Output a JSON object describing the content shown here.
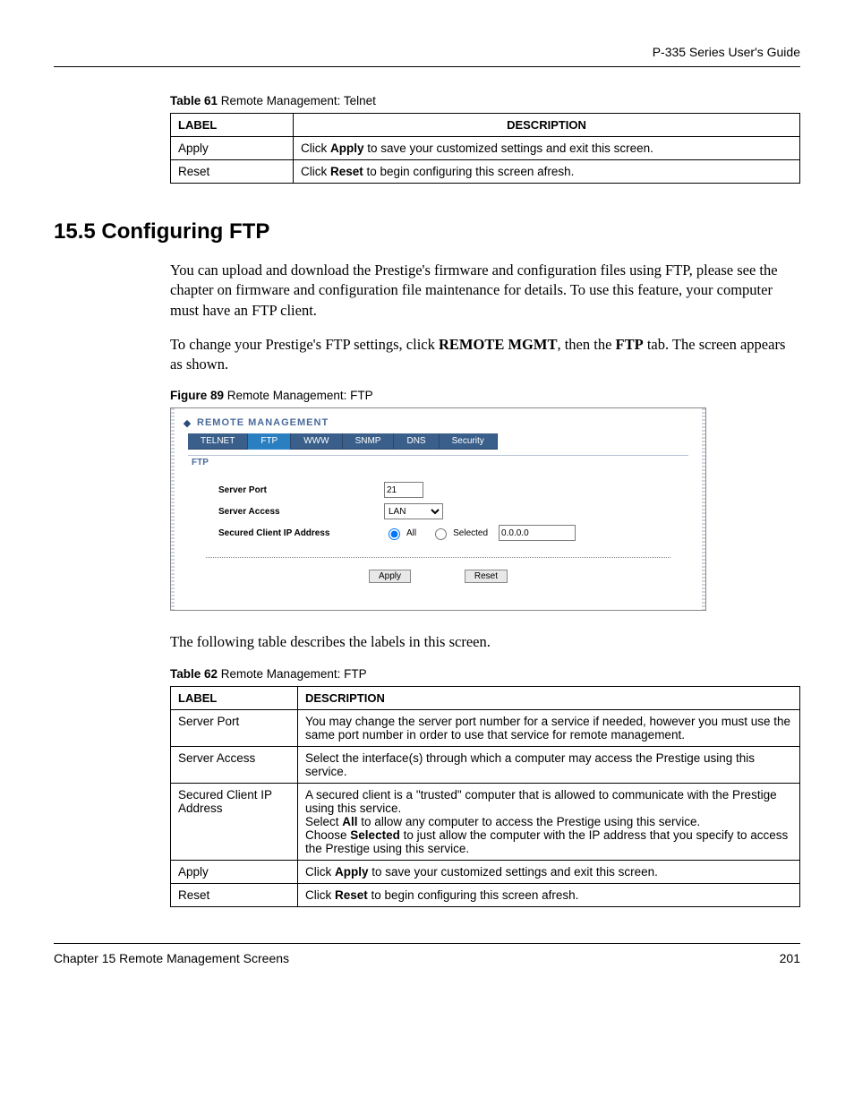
{
  "header": {
    "doc_title": "P-335 Series User's Guide"
  },
  "table61": {
    "caption_bold": "Table 61",
    "caption_rest": "   Remote Management: Telnet",
    "head_label": "LABEL",
    "head_desc": "DESCRIPTION",
    "rows": [
      {
        "label": "Apply",
        "pre": "Click ",
        "bold": "Apply",
        "post": " to save your customized settings and exit this screen."
      },
      {
        "label": "Reset",
        "pre": "Click ",
        "bold": "Reset",
        "post": " to begin configuring this screen afresh."
      }
    ]
  },
  "section": {
    "heading": "15.5  Configuring FTP",
    "p1": "You can upload and download the Prestige's firmware and configuration files using FTP, please see the chapter on firmware and configuration file maintenance for details. To use this feature, your computer must have an FTP client.",
    "p2_pre": "To change your Prestige's FTP settings, click ",
    "p2_b1": "REMOTE MGMT",
    "p2_mid": ", then the ",
    "p2_b2": "FTP",
    "p2_post": " tab. The screen appears as shown."
  },
  "figure89": {
    "caption_bold": "Figure 89",
    "caption_rest": "   Remote Management: FTP",
    "panel_title": "REMOTE MANAGEMENT",
    "tabs": [
      "TELNET",
      "FTP",
      "WWW",
      "SNMP",
      "DNS",
      "Security"
    ],
    "active_tab_index": 1,
    "sub_label": "FTP",
    "fields": {
      "server_port_label": "Server Port",
      "server_port_value": "21",
      "server_access_label": "Server Access",
      "server_access_value": "LAN",
      "secured_label": "Secured Client IP Address",
      "radio_all": "All",
      "radio_selected": "Selected",
      "ip_value": "0.0.0.0"
    },
    "buttons": {
      "apply": "Apply",
      "reset": "Reset"
    }
  },
  "after_fig_text": "The following table describes the labels in this screen.",
  "table62": {
    "caption_bold": "Table 62",
    "caption_rest": "   Remote Management: FTP",
    "head_label": "LABEL",
    "head_desc": "DESCRIPTION",
    "rows": [
      {
        "label": "Server Port",
        "lines": [
          {
            "t": "You may change the server port number for a service if needed, however you must use the same port number in order to use that service for remote management."
          }
        ]
      },
      {
        "label": "Server Access",
        "lines": [
          {
            "t": "Select the interface(s) through which a computer may access the Prestige using this service."
          }
        ]
      },
      {
        "label": "Secured Client IP Address",
        "lines": [
          {
            "t": "A secured client is a \"trusted\" computer that is allowed to communicate with the Prestige using this service."
          },
          {
            "pre": "Select ",
            "b": "All",
            "post": " to allow any computer to access the Prestige using this service."
          },
          {
            "pre": "Choose ",
            "b": "Selected",
            "post": " to just allow the computer with the IP address that you specify to access the Prestige using this service."
          }
        ]
      },
      {
        "label": "Apply",
        "lines": [
          {
            "pre": "Click ",
            "b": "Apply",
            "post": " to save your customized settings and exit this screen."
          }
        ]
      },
      {
        "label": "Reset",
        "lines": [
          {
            "pre": "Click ",
            "b": "Reset",
            "post": " to begin configuring this screen afresh."
          }
        ]
      }
    ]
  },
  "footer": {
    "left": "Chapter 15 Remote Management Screens",
    "right": "201"
  }
}
